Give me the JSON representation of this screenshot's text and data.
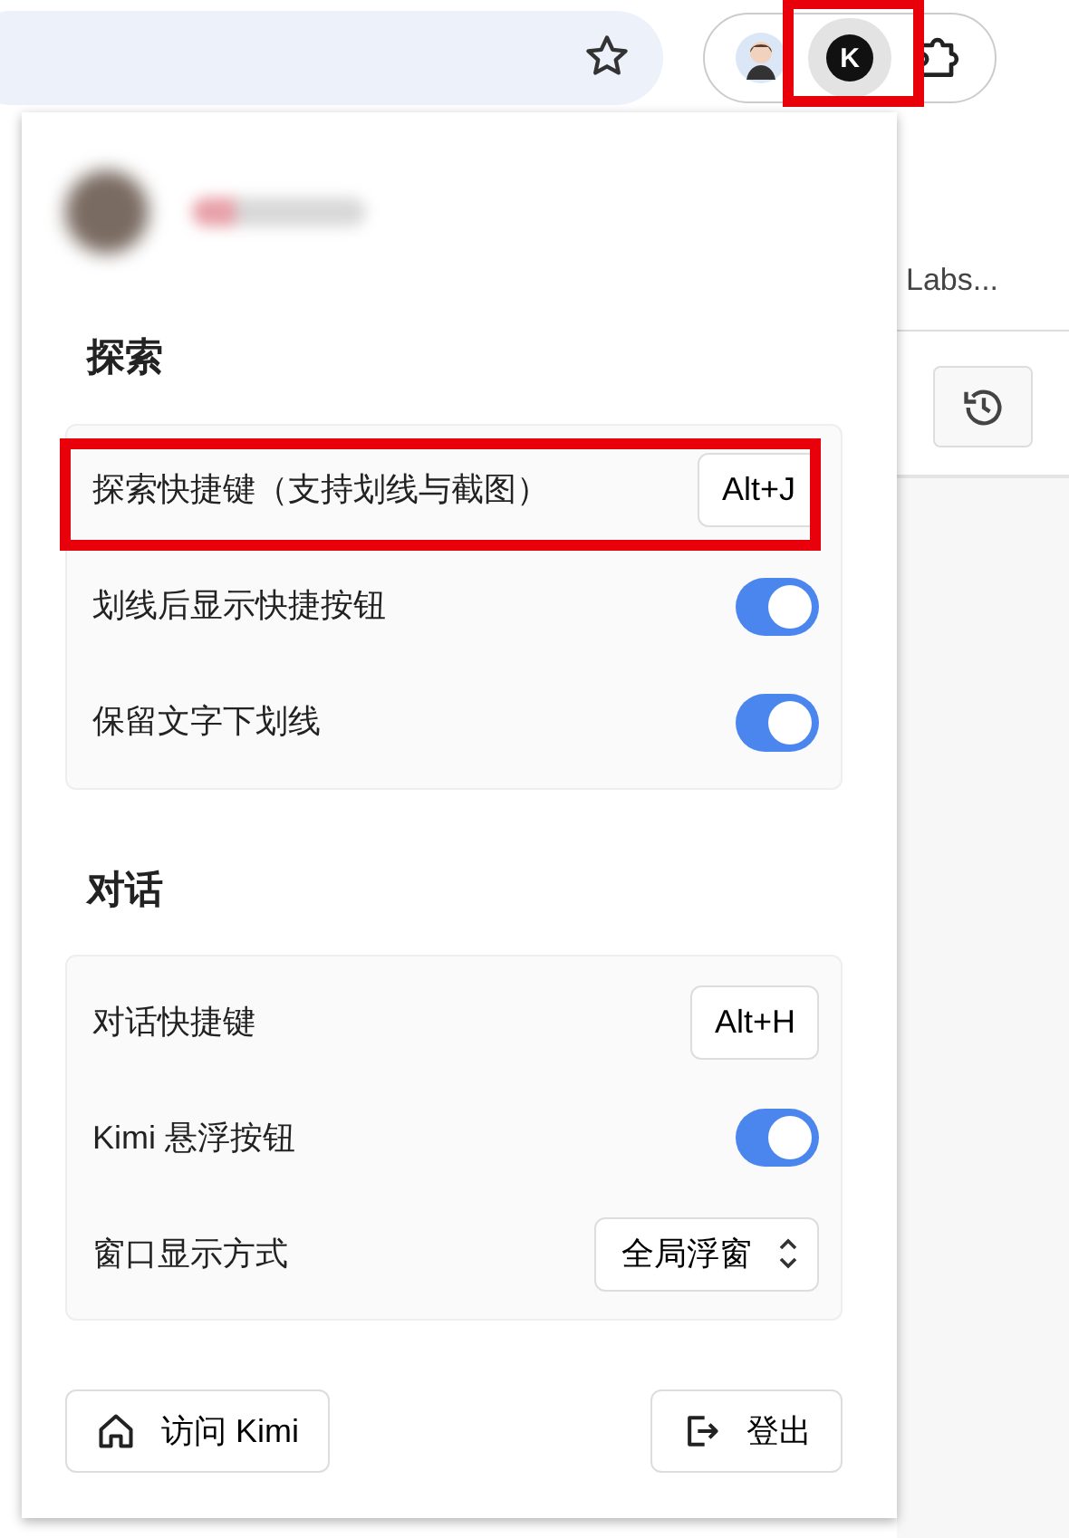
{
  "toolbar": {
    "extensions": [
      {
        "kind": "avatar",
        "highlighted": false
      },
      {
        "kind": "kimi",
        "logo_letter": "K",
        "highlighted": true
      },
      {
        "kind": "puzzle",
        "highlighted": false
      }
    ]
  },
  "background_page": {
    "link_text": "Labs..."
  },
  "popup": {
    "sections": [
      {
        "title": "探索",
        "rows": [
          {
            "kind": "shortcut",
            "label": "探索快捷键（支持划线与截图）",
            "key": "Alt+J",
            "highlighted": true
          },
          {
            "kind": "toggle",
            "label": "划线后显示快捷按钮",
            "on": true
          },
          {
            "kind": "toggle",
            "label": "保留文字下划线",
            "on": true
          }
        ]
      },
      {
        "title": "对话",
        "rows": [
          {
            "kind": "shortcut",
            "label": "对话快捷键",
            "key": "Alt+H",
            "highlighted": false
          },
          {
            "kind": "toggle",
            "label": "Kimi 悬浮按钮",
            "on": true
          },
          {
            "kind": "select",
            "label": "窗口显示方式",
            "value": "全局浮窗"
          }
        ]
      }
    ],
    "buttons": [
      {
        "kind": "home",
        "label": "访问 Kimi"
      },
      {
        "kind": "logout",
        "label": "登出"
      }
    ]
  }
}
